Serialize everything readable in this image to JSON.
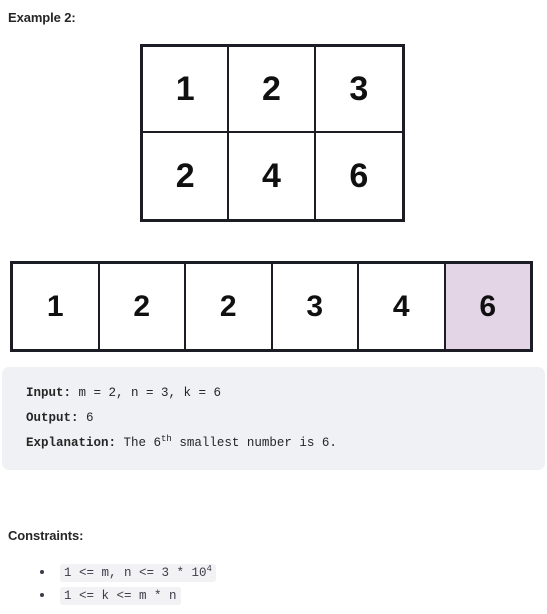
{
  "example": {
    "heading": "Example 2:",
    "matrix": {
      "rows": 2,
      "cols": 3,
      "cells": [
        [
          "1",
          "2",
          "3"
        ],
        [
          "2",
          "4",
          "6"
        ]
      ]
    },
    "sorted_array": {
      "values": [
        "1",
        "2",
        "2",
        "3",
        "4",
        "6"
      ],
      "highlight_index": 5,
      "highlight_color": "#e4d5e6"
    },
    "io": {
      "input_label": "Input:",
      "input_value": " m = 2, n = 3, k = 6",
      "output_label": "Output:",
      "output_value": " 6",
      "explanation_label": "Explanation:",
      "explanation_prefix": " The 6",
      "explanation_sup": "th",
      "explanation_suffix": " smallest number is 6."
    }
  },
  "constraints": {
    "heading": "Constraints:",
    "items": [
      {
        "prefix": "1 <= m, n <= 3 * 10",
        "sup": "4",
        "suffix": ""
      },
      {
        "prefix": "1 <= k <= m * n",
        "sup": "",
        "suffix": ""
      }
    ]
  }
}
